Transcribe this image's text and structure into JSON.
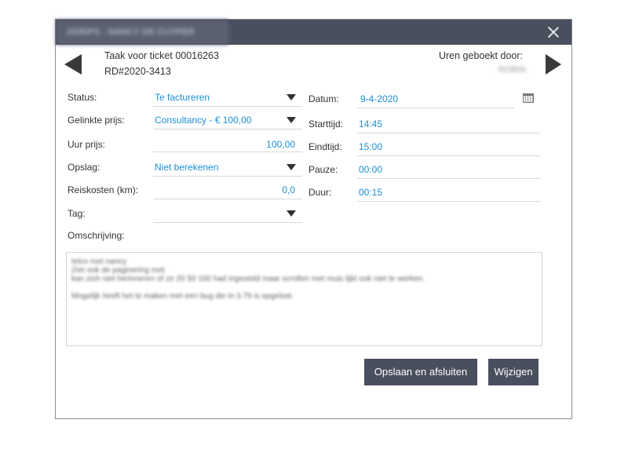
{
  "window": {
    "title": "2GRIPS - NANCY DE CUYPER"
  },
  "header": {
    "ticket_title": "Taak voor ticket 00016263",
    "ticket_ref": "RD#2020-3413",
    "hours_booked_label": "Uren geboekt door:",
    "hours_booked_user": "ROBIN"
  },
  "form_left": {
    "status": {
      "label": "Status:",
      "value": "Te factureren"
    },
    "linked_price": {
      "label": "Gelinkte prijs:",
      "value": "Consultancy - € 100,00"
    },
    "hour_price": {
      "label": "Uur prijs:",
      "value": "100,00"
    },
    "surcharge": {
      "label": "Opslag:",
      "value": "Niet berekenen"
    },
    "travel": {
      "label": "Reiskosten (km):",
      "value": "0,0"
    },
    "tag": {
      "label": "Tag:",
      "value": ""
    },
    "description_label": "Omschrijving:"
  },
  "form_right": {
    "date": {
      "label": "Datum:",
      "value": "9-4-2020"
    },
    "start": {
      "label": "Starttijd:",
      "value": "14:45"
    },
    "end": {
      "label": "Eindtijd:",
      "value": "15:00"
    },
    "pause": {
      "label": "Pauze:",
      "value": "00:00"
    },
    "duration": {
      "label": "Duur:",
      "value": "00:15"
    }
  },
  "description": {
    "lines": [
      "telco met nancy",
      "Ziet ook de paginering met.",
      "kan zich niet herinneren of ze 20 50 100 had ingesteld maar scrollen met muis lijkt ook niet te werken.",
      "",
      "Mogelijk heeft het te maken met een bug die in 3.79 is opgelost."
    ]
  },
  "buttons": {
    "save_close": "Opslaan en afsluiten",
    "edit": "Wijzigen"
  },
  "colors": {
    "titlebar": "#4a4f5e",
    "value_blue": "#1a8fd6",
    "button": "#4a4f5e"
  }
}
